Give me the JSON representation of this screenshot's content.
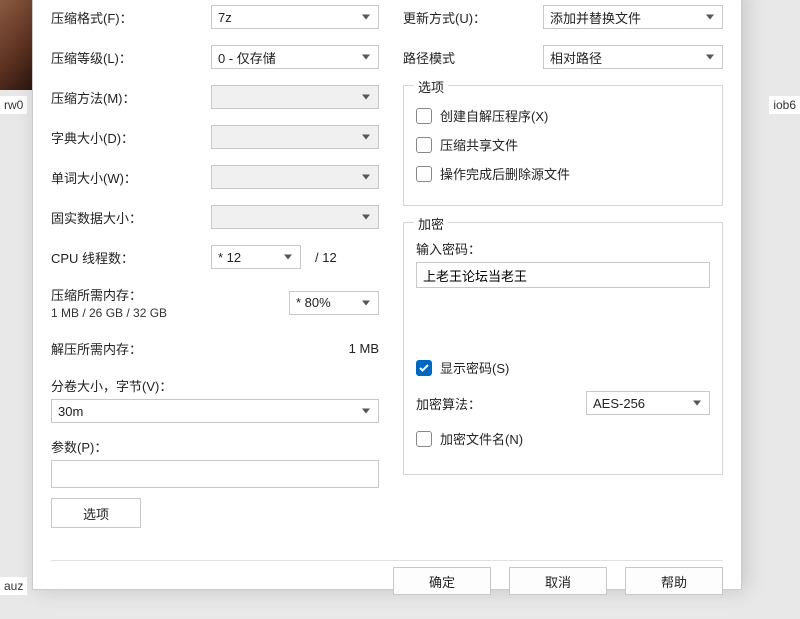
{
  "bg": {
    "left_text": "rw0",
    "right_text": "iob6",
    "bottom_text": "auz"
  },
  "left": {
    "format_label": "压缩格式(F)：",
    "format_value": "7z",
    "level_label": "压缩等级(L)：",
    "level_value": "0 - 仅存储",
    "method_label": "压缩方法(M)：",
    "dict_label": "字典大小(D)：",
    "word_label": "单词大小(W)：",
    "solid_label": "固实数据大小：",
    "threads_label": "CPU 线程数：",
    "threads_value": "* 12",
    "threads_total": "/ 12",
    "compress_mem_label": "压缩所需内存：",
    "compress_mem_sub": "1 MB / 26 GB / 32 GB",
    "compress_mem_pct": "* 80%",
    "decompress_mem_label": "解压所需内存：",
    "decompress_mem_val": "1 MB",
    "split_label": "分卷大小，字节(V)：",
    "split_value": "30m",
    "params_label": "参数(P)：",
    "params_value": "",
    "options_btn": "选项"
  },
  "right": {
    "update_label": "更新方式(U)：",
    "update_value": "添加并替换文件",
    "path_label": "路径模式",
    "path_value": "相对路径",
    "options_legend": "选项",
    "opt_sfx": "创建自解压程序(X)",
    "opt_shared": "压缩共享文件",
    "opt_delete": "操作完成后删除源文件",
    "enc_legend": "加密",
    "pwd_label": "输入密码：",
    "pwd_value": "上老王论坛当老王",
    "show_pwd": "显示密码(S)",
    "enc_method_label": "加密算法：",
    "enc_method_value": "AES-256",
    "enc_names": "加密文件名(N)"
  },
  "buttons": {
    "ok": "确定",
    "cancel": "取消",
    "help": "帮助"
  }
}
